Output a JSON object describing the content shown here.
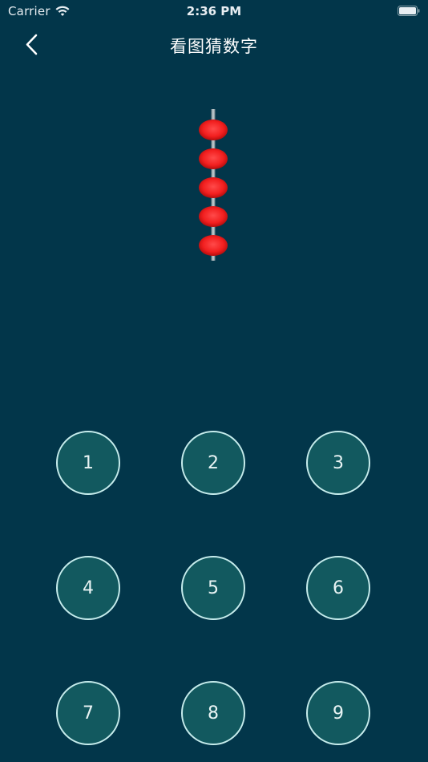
{
  "status_bar": {
    "carrier": "Carrier",
    "time": "2:36 PM",
    "wifi_icon": "wifi-icon",
    "battery_icon": "battery-icon"
  },
  "nav": {
    "back_icon": "chevron-left-icon",
    "title": "看图猜数字"
  },
  "puzzle": {
    "image": "abacus-rod",
    "bead_count": 5,
    "bead_color": "#ff2a2a"
  },
  "keypad": {
    "keys": [
      "1",
      "2",
      "3",
      "4",
      "5",
      "6",
      "7",
      "8",
      "9"
    ]
  },
  "colors": {
    "background": "#02364a",
    "key_fill": "#12595f",
    "key_border": "#c6ecec",
    "text": "#ffffff"
  }
}
